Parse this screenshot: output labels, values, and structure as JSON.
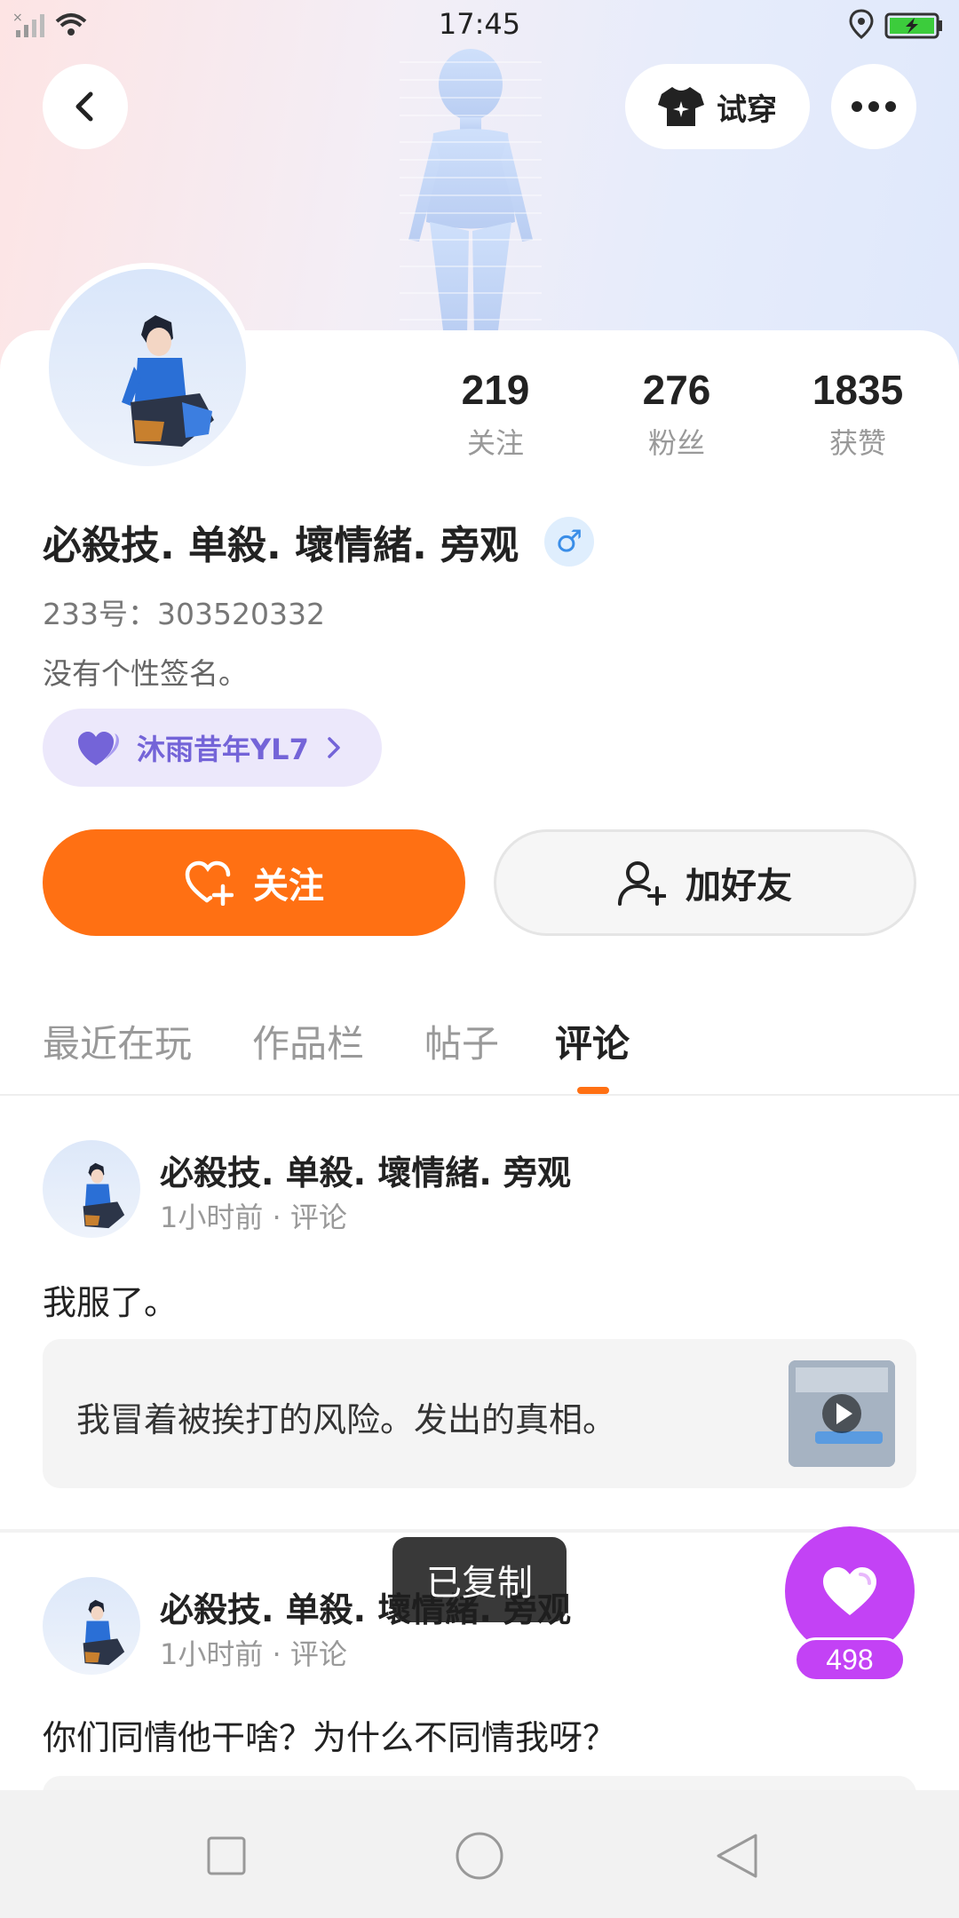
{
  "status_bar": {
    "time": "17:45"
  },
  "header": {
    "tryon_label": "试穿"
  },
  "profile": {
    "stats": [
      {
        "value": "219",
        "label": "关注"
      },
      {
        "value": "276",
        "label": "粉丝"
      },
      {
        "value": "1835",
        "label": "获赞"
      }
    ],
    "name": "必殺技. 单殺. 壞情緒. 旁观",
    "gender_symbol": "♂",
    "id_text": "233号：303520332",
    "signature": "没有个性签名。",
    "guild_name": "沐雨昔年YL7",
    "follow_label": "关注",
    "add_friend_label": "加好友"
  },
  "tabs": [
    {
      "label": "最近在玩",
      "active": false
    },
    {
      "label": "作品栏",
      "active": false
    },
    {
      "label": "帖子",
      "active": false
    },
    {
      "label": "评论",
      "active": true
    }
  ],
  "posts": [
    {
      "author": "必殺技. 单殺. 壞情緒. 旁观",
      "meta": "1小时前 · 评论",
      "text": "我服了。",
      "quote": "我冒着被挨打的风险。发出的真相。"
    },
    {
      "author": "必殺技. 单殺. 壞情緒. 旁观",
      "meta": "1小时前 · 评论",
      "text": "你们同情他干啥？为什么不同情我呀？"
    }
  ],
  "toast": "已复制",
  "like": {
    "count": "498"
  },
  "colors": {
    "accent": "#ff7013",
    "like": "#c342f5",
    "guild": "#7464d8"
  }
}
